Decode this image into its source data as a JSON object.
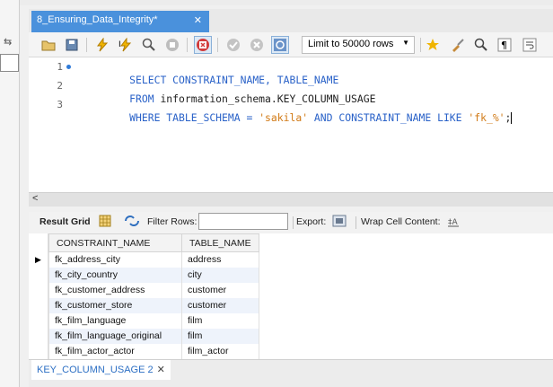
{
  "tab": {
    "title": "8_Ensuring_Data_Integrity*",
    "close": "✕"
  },
  "toolbar": {
    "limit_label": "Limit to 50000 rows",
    "icons": [
      "open-folder-icon",
      "save-icon",
      "execute-icon",
      "execute-current-icon",
      "explain-icon",
      "stop-icon",
      "toggle-error-icon",
      "commit-icon",
      "rollback-icon",
      "autocommit-icon",
      "beautify-icon",
      "find-icon",
      "invisibles-icon",
      "wrap-icon"
    ]
  },
  "editor": {
    "lines": [
      {
        "num": "1",
        "tokens": [
          {
            "t": "SELECT",
            "c": "kw"
          },
          {
            "t": " CONSTRAINT_NAME, TABLE_NAME",
            "c": "kw"
          }
        ]
      },
      {
        "num": "2",
        "tokens": [
          {
            "t": "FROM",
            "c": "kw"
          },
          {
            "t": " information_schema.KEY_COLUMN_USAGE",
            "c": "pl"
          }
        ]
      },
      {
        "num": "3",
        "tokens": [
          {
            "t": "WHERE",
            "c": "kw"
          },
          {
            "t": " TABLE_SCHEMA = ",
            "c": "kw"
          },
          {
            "t": "'sakila'",
            "c": "str"
          },
          {
            "t": " AND",
            "c": "kw"
          },
          {
            "t": " CONSTRAINT_NAME ",
            "c": "kw"
          },
          {
            "t": "LIKE",
            "c": "kw"
          },
          {
            "t": " ",
            "c": "pl"
          },
          {
            "t": "'fk_%'",
            "c": "str"
          },
          {
            "t": ";",
            "c": "pl"
          }
        ]
      }
    ]
  },
  "result_toolbar": {
    "result_grid": "Result Grid",
    "filter_rows": "Filter Rows:",
    "export": "Export:",
    "wrap_cell": "Wrap Cell Content:"
  },
  "grid": {
    "columns": [
      "CONSTRAINT_NAME",
      "TABLE_NAME"
    ],
    "rows": [
      [
        "fk_address_city",
        "address"
      ],
      [
        "fk_city_country",
        "city"
      ],
      [
        "fk_customer_address",
        "customer"
      ],
      [
        "fk_customer_store",
        "customer"
      ],
      [
        "fk_film_language",
        "film"
      ],
      [
        "fk_film_language_original",
        "film"
      ],
      [
        "fk_film_actor_actor",
        "film_actor"
      ]
    ]
  },
  "bottom_tab": {
    "label": "KEY_COLUMN_USAGE 2",
    "close": "✕"
  },
  "colors": {
    "accent": "#4a91dc",
    "keyword": "#2a62c8",
    "string": "#d17a16"
  }
}
